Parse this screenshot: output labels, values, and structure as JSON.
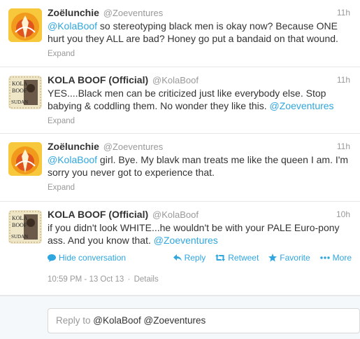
{
  "tweets": [
    {
      "name": "Zoëlunchie",
      "handle": "@Zoeventures",
      "time": "11h",
      "lines": [
        [
          {
            "t": "@KolaBoof",
            "link": true
          },
          {
            "t": " so stereotyping black men is okay now? Because ONE"
          }
        ],
        [
          {
            "t": "hurt you they ALL are bad? Honey go put a bandaid on that wound."
          }
        ]
      ],
      "expand": "Expand",
      "avatar": "zoe"
    },
    {
      "name": "KOLA BOOF (Official)",
      "handle": "@KolaBoof",
      "time": "11h",
      "lines": [
        [
          {
            "t": "YES....Black men can be criticized just like everybody else. Stop"
          }
        ],
        [
          {
            "t": "babying & coddling them. No wonder they like this. "
          },
          {
            "t": "@Zoeventures",
            "link": true
          }
        ]
      ],
      "expand": "Expand",
      "avatar": "kola",
      "avatar_text": [
        "KOLA",
        "BOOF",
        "SUDAN"
      ]
    },
    {
      "name": "Zoëlunchie",
      "handle": "@Zoeventures",
      "time": "11h",
      "lines": [
        [
          {
            "t": "@KolaBoof",
            "link": true
          },
          {
            "t": " girl. Bye. My blavk man treats me like the queen I am. I'm"
          }
        ],
        [
          {
            "t": "sorry you never got to experience that."
          }
        ]
      ],
      "expand": "Expand",
      "avatar": "zoe"
    },
    {
      "name": "KOLA BOOF (Official)",
      "handle": "@KolaBoof",
      "time": "10h",
      "lines": [
        [
          {
            "t": "if you didn't look WHITE...he wouldn't be with your PALE Euro-pony"
          }
        ],
        [
          {
            "t": "ass. And you know that. "
          },
          {
            "t": "@Zoeventures",
            "link": true
          }
        ]
      ],
      "avatar": "kola",
      "avatar_text": [
        "KOLA",
        "BOOF",
        "SUDAN"
      ],
      "actions": {
        "hide": "Hide conversation",
        "reply": "Reply",
        "retweet": "Retweet",
        "favorite": "Favorite",
        "more": "More"
      },
      "meta": {
        "time": "10:59 PM - 13 Oct 13",
        "separator": "·",
        "details": "Details"
      }
    }
  ],
  "reply_box": {
    "prefix": "Reply to ",
    "mentions": "@KolaBoof @Zoeventures"
  },
  "colors": {
    "link": "#2fa6de",
    "muted": "#999999",
    "text": "#333333",
    "background": "#f5f8fa"
  }
}
